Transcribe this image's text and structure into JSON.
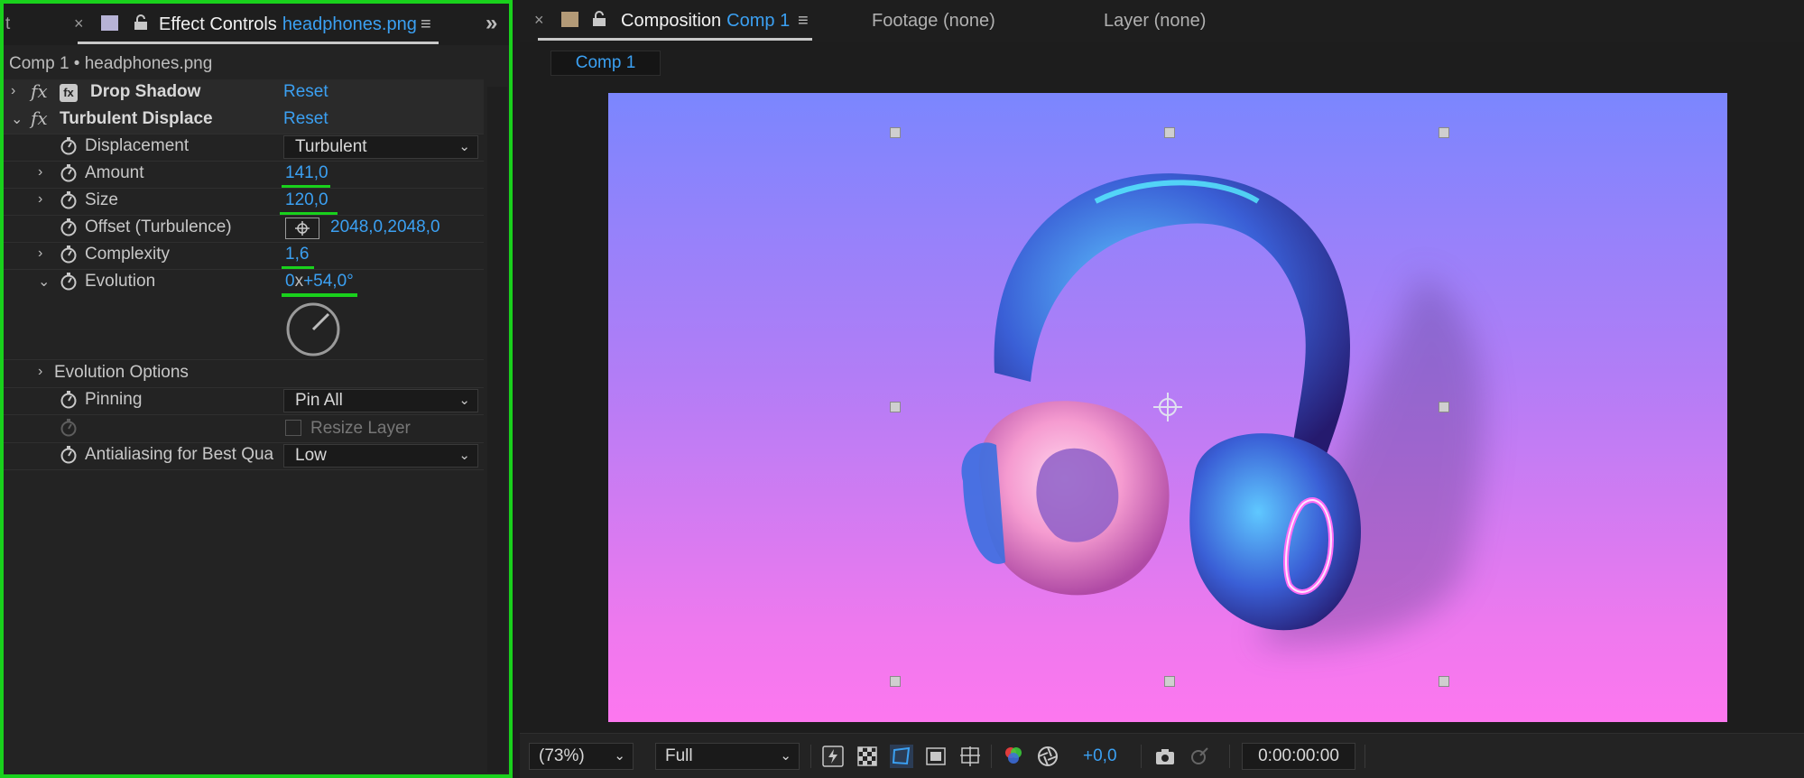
{
  "effect_controls": {
    "tab_stub": "t",
    "close": "×",
    "title": "Effect Controls",
    "file": "headphones.png",
    "menu": "≡",
    "more": "»",
    "subtitle": "Comp 1 • headphones.png",
    "effects": [
      {
        "name": "Drop Shadow",
        "reset": "Reset"
      },
      {
        "name": "Turbulent Displace",
        "reset": "Reset"
      }
    ],
    "props": {
      "displacement": {
        "label": "Displacement",
        "value": "Turbulent"
      },
      "amount": {
        "label": "Amount",
        "value": "141,0"
      },
      "size": {
        "label": "Size",
        "value": "120,0"
      },
      "offset": {
        "label": "Offset (Turbulence)",
        "value": "2048,0,2048,0"
      },
      "complexity": {
        "label": "Complexity",
        "value": "1,6"
      },
      "evolution": {
        "label": "Evolution",
        "rev": "0",
        "x": "x",
        "deg": "+54,0°"
      },
      "evolution_options": {
        "label": "Evolution Options"
      },
      "pinning": {
        "label": "Pinning",
        "value": "Pin All"
      },
      "resize_layer": {
        "label": "Resize Layer"
      },
      "antialiasing": {
        "label": "Antialiasing for Best Qua",
        "value": "Low"
      }
    }
  },
  "composition": {
    "close": "×",
    "title": "Composition",
    "comp_name": "Comp 1",
    "menu": "≡",
    "footage_tab": "Footage (none)",
    "layer_tab": "Layer (none)",
    "comp_button": "Comp 1"
  },
  "toolbar": {
    "zoom": "(73%)",
    "resolution": "Full",
    "exposure": "+0,0",
    "timecode": "0:00:00:00"
  },
  "colors": {
    "accent": "#3ba0f2",
    "highlight": "#19d11c",
    "gradient_top": "#7b86fe",
    "gradient_bottom": "#fd77ef"
  }
}
